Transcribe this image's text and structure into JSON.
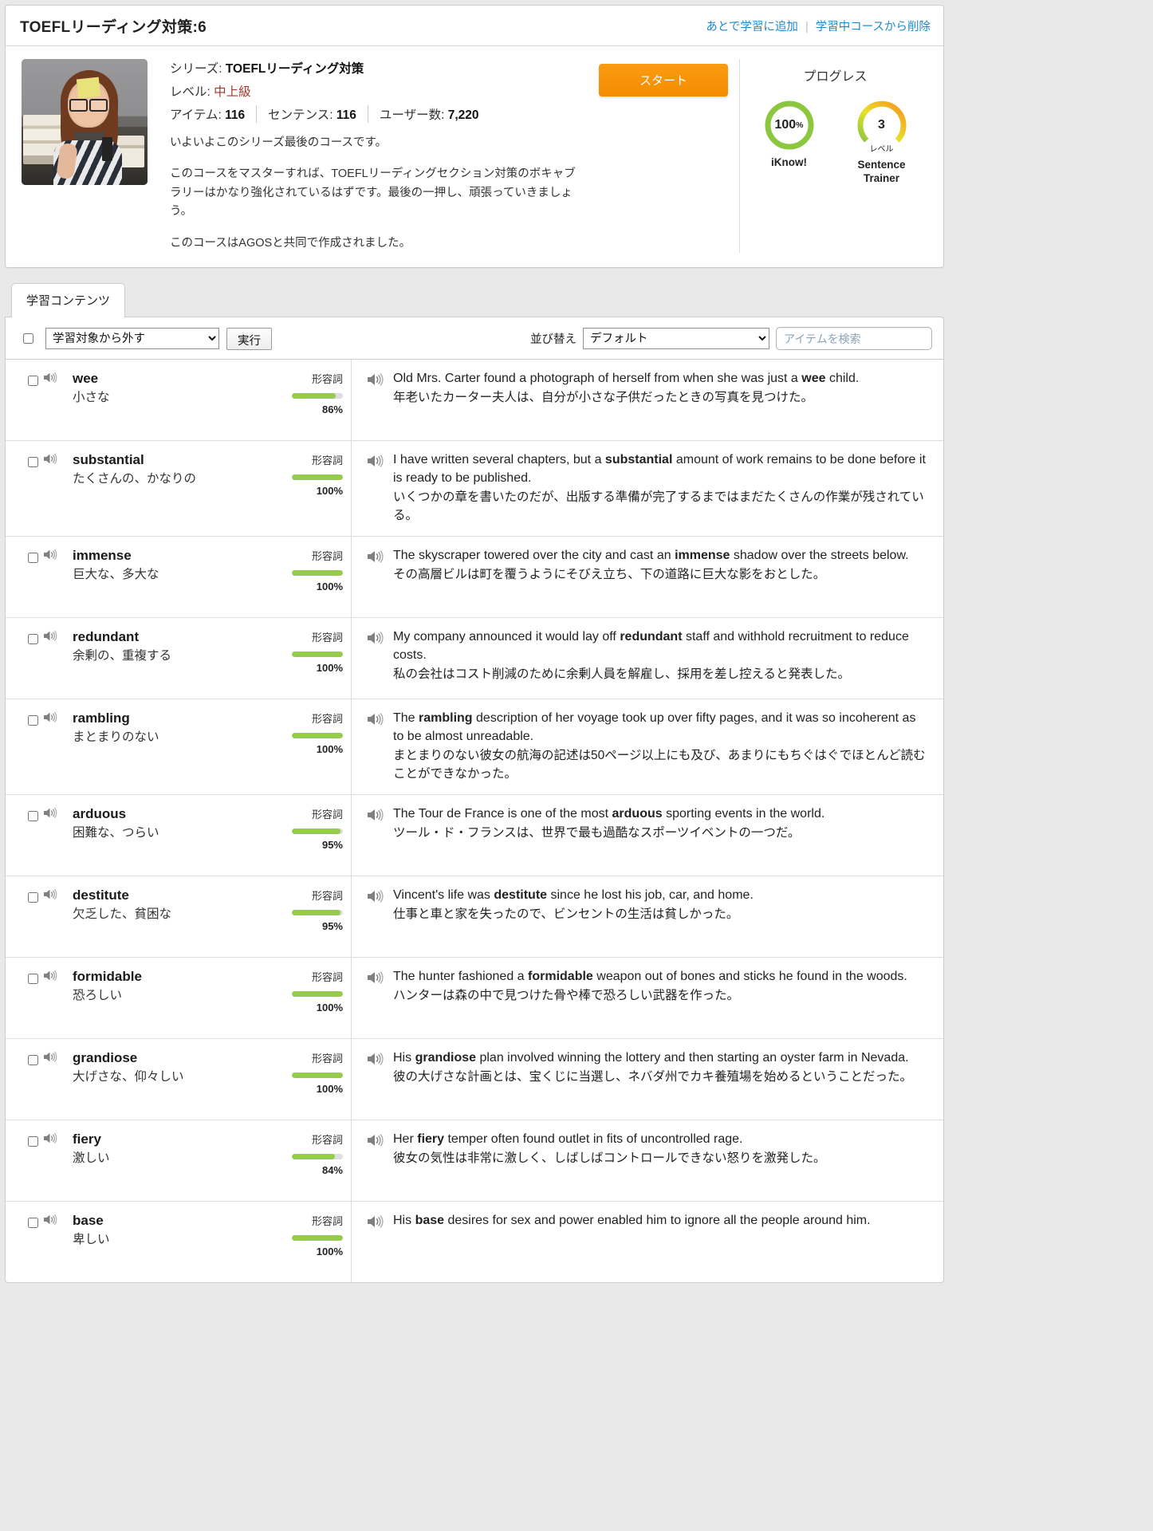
{
  "header": {
    "course_title": "TOEFLリーディング対策:6",
    "link_add_later": "あとで学習に追加",
    "link_remove": "学習中コースから削除"
  },
  "course": {
    "series_label": "シリーズ:",
    "series_value": "TOEFLリーディング対策",
    "level_label": "レベル:",
    "level_value": "中上級",
    "items_label": "アイテム:",
    "items_value": "116",
    "sentences_label": "センテンス:",
    "sentences_value": "116",
    "users_label": "ユーザー数:",
    "users_value": "7,220",
    "description_1": "いよいよこのシリーズ最後のコースです。",
    "description_2": "このコースをマスターすれば、TOEFLリーディングセクション対策のボキャブラリーはかなり強化されているはずです。最後の一押し、頑張っていきましょう。",
    "description_3": "このコースはAGOSと共同で作成されました。",
    "start_button": "スタート"
  },
  "progress": {
    "title": "プログレス",
    "iknow": {
      "value": "100",
      "unit": "%",
      "label": "iKnow!",
      "percent": 100,
      "color": "#8dc63f"
    },
    "sentence_trainer": {
      "value": "3",
      "sub": "レベル",
      "label": "Sentence Trainer",
      "percent": 72,
      "color_start": "#8dc63f",
      "color_end": "#f7941e"
    }
  },
  "tabs": [
    {
      "label": "学習コンテンツ",
      "active": true
    }
  ],
  "toolbar": {
    "bulk_action_selected": "学習対象から外す",
    "bulk_action_options": [
      "学習対象から外す"
    ],
    "execute_label": "実行",
    "sort_label": "並び替え",
    "sort_selected": "デフォルト",
    "sort_options": [
      "デフォルト"
    ],
    "search_placeholder": "アイテムを検索"
  },
  "items": [
    {
      "word": "wee",
      "translation": "小さな",
      "pos": "形容詞",
      "percent": 86,
      "percent_label": "86%",
      "sentence_pre": "Old Mrs. Carter found a photograph of herself from when she was just a ",
      "sentence_bold": "wee",
      "sentence_post": " child.",
      "sentence_jp": "年老いたカーター夫人は、自分が小さな子供だったときの写真を見つけた。"
    },
    {
      "word": "substantial",
      "translation": "たくさんの、かなりの",
      "pos": "形容詞",
      "percent": 100,
      "percent_label": "100%",
      "sentence_pre": "I have written several chapters, but a ",
      "sentence_bold": "substantial",
      "sentence_post": " amount of work remains to be done before it is ready to be published.",
      "sentence_jp": "いくつかの章を書いたのだが、出版する準備が完了するまではまだたくさんの作業が残されている。"
    },
    {
      "word": "immense",
      "translation": "巨大な、多大な",
      "pos": "形容詞",
      "percent": 100,
      "percent_label": "100%",
      "sentence_pre": "The skyscraper towered over the city and cast an ",
      "sentence_bold": "immense",
      "sentence_post": " shadow over the streets below.",
      "sentence_jp": "その高層ビルは町を覆うようにそびえ立ち、下の道路に巨大な影をおとした。"
    },
    {
      "word": "redundant",
      "translation": "余剰の、重複する",
      "pos": "形容詞",
      "percent": 100,
      "percent_label": "100%",
      "sentence_pre": "My company announced it would lay off ",
      "sentence_bold": "redundant",
      "sentence_post": " staff and withhold recruitment to reduce costs.",
      "sentence_jp": "私の会社はコスト削減のために余剰人員を解雇し、採用を差し控えると発表した。"
    },
    {
      "word": "rambling",
      "translation": "まとまりのない",
      "pos": "形容詞",
      "percent": 100,
      "percent_label": "100%",
      "sentence_pre": "The ",
      "sentence_bold": "rambling",
      "sentence_post": " description of her voyage took up over fifty pages, and it was so incoherent as to be almost unreadable.",
      "sentence_jp": "まとまりのない彼女の航海の記述は50ページ以上にも及び、あまりにもちぐはぐでほとんど読むことができなかった。"
    },
    {
      "word": "arduous",
      "translation": "困難な、つらい",
      "pos": "形容詞",
      "percent": 95,
      "percent_label": "95%",
      "sentence_pre": "The Tour de France is one of the most ",
      "sentence_bold": "arduous",
      "sentence_post": " sporting events in the world.",
      "sentence_jp": "ツール・ド・フランスは、世界で最も過酷なスポーツイベントの一つだ。"
    },
    {
      "word": "destitute",
      "translation": "欠乏した、貧困な",
      "pos": "形容詞",
      "percent": 95,
      "percent_label": "95%",
      "sentence_pre": "Vincent's life was ",
      "sentence_bold": "destitute",
      "sentence_post": " since he lost his job, car, and home.",
      "sentence_jp": "仕事と車と家を失ったので、ビンセントの生活は貧しかった。"
    },
    {
      "word": "formidable",
      "translation": "恐ろしい",
      "pos": "形容詞",
      "percent": 100,
      "percent_label": "100%",
      "sentence_pre": "The hunter fashioned a ",
      "sentence_bold": "formidable",
      "sentence_post": " weapon out of bones and sticks he found in the woods.",
      "sentence_jp": "ハンターは森の中で見つけた骨や棒で恐ろしい武器を作った。"
    },
    {
      "word": "grandiose",
      "translation": "大げさな、仰々しい",
      "pos": "形容詞",
      "percent": 100,
      "percent_label": "100%",
      "sentence_pre": "His ",
      "sentence_bold": "grandiose",
      "sentence_post": " plan involved winning the lottery and then starting an oyster farm in Nevada.",
      "sentence_jp": "彼の大げさな計画とは、宝くじに当選し、ネバダ州でカキ養殖場を始めるということだった。"
    },
    {
      "word": "fiery",
      "translation": "激しい",
      "pos": "形容詞",
      "percent": 84,
      "percent_label": "84%",
      "sentence_pre": "Her ",
      "sentence_bold": "fiery",
      "sentence_post": " temper often found outlet in fits of uncontrolled rage.",
      "sentence_jp": "彼女の気性は非常に激しく、しばしばコントロールできない怒りを激発した。"
    },
    {
      "word": "base",
      "translation": "卑しい",
      "pos": "形容詞",
      "percent": 100,
      "percent_label": "100%",
      "sentence_pre": "His ",
      "sentence_bold": "base",
      "sentence_post": " desires for sex and power enabled him to ignore all the people around him.",
      "sentence_jp": ""
    }
  ]
}
